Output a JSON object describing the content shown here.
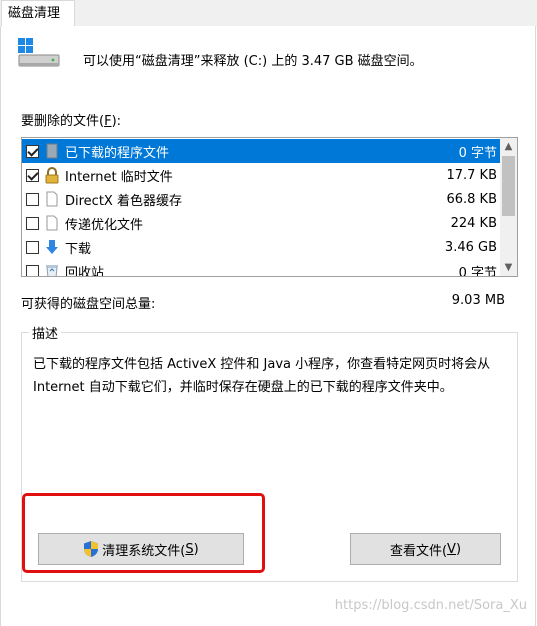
{
  "tab": {
    "label": "磁盘清理"
  },
  "summary": "可以使用“磁盘清理”来释放  (C:) 上的 3.47 GB 磁盘空间。",
  "files_label": {
    "prefix": "要删除的文件(",
    "accel": "F",
    "suffix": "):"
  },
  "file_list": [
    {
      "name": "已下载的程序文件",
      "size": "0 字节",
      "checked": true,
      "icon": "folder-icon",
      "selected": true
    },
    {
      "name": "Internet 临时文件",
      "size": "17.7 KB",
      "checked": true,
      "icon": "lock-icon",
      "selected": false
    },
    {
      "name": "DirectX 着色器缓存",
      "size": "66.8 KB",
      "checked": false,
      "icon": "document-icon",
      "selected": false
    },
    {
      "name": "传递优化文件",
      "size": "224 KB",
      "checked": false,
      "icon": "document-icon",
      "selected": false
    },
    {
      "name": "下载",
      "size": "3.46 GB",
      "checked": false,
      "icon": "download-arrow-icon",
      "selected": false
    },
    {
      "name": "回收站",
      "size": "0 字节",
      "checked": false,
      "icon": "recycle-bin-icon",
      "selected": false
    }
  ],
  "total": {
    "label": "可获得的磁盘空间总量:",
    "value": "9.03 MB"
  },
  "description": {
    "title": "描述",
    "text": "已下载的程序文件包括 ActiveX 控件和 Java 小程序，你查看特定网页时将会从 Internet 自动下载它们，并临时保存在硬盘上的已下载的程序文件夹中。"
  },
  "buttons": {
    "clean_system": {
      "prefix": "清理系统文件(",
      "accel": "S",
      "suffix": ")"
    },
    "view_files": {
      "prefix": "查看文件(",
      "accel": "V",
      "suffix": ")"
    }
  },
  "watermark": "https://blog.csdn.net/Sora_Xu",
  "colors": {
    "selection": "#0078d7",
    "highlight_border": "#e01010",
    "accent_blue": "#1e88e5"
  }
}
